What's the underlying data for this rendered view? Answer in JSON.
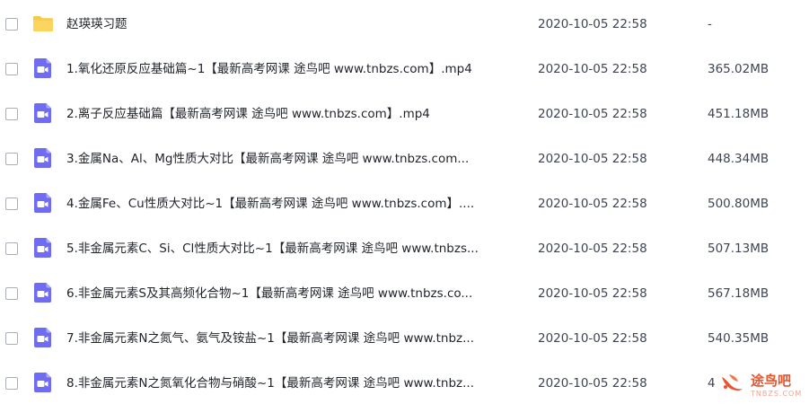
{
  "colors": {
    "folder": "#f7c948",
    "video": "#6f6cf2",
    "watermark": "#e8552d"
  },
  "files": [
    {
      "name": "赵瑛瑛习题",
      "date": "2020-10-05 22:58",
      "size": "-",
      "icon": "folder-icon"
    },
    {
      "name": "1.氧化还原反应基础篇~1【最新高考网课 途鸟吧 www.tnbzs.com】.mp4",
      "date": "2020-10-05 22:58",
      "size": "365.02MB",
      "icon": "video-file-icon"
    },
    {
      "name": "2.离子反应基础篇【最新高考网课 途鸟吧 www.tnbzs.com】.mp4",
      "date": "2020-10-05 22:58",
      "size": "451.18MB",
      "icon": "video-file-icon"
    },
    {
      "name": "3.金属Na、Al、Mg性质大对比【最新高考网课 途鸟吧 www.tnbzs.com...",
      "date": "2020-10-05 22:58",
      "size": "448.34MB",
      "icon": "video-file-icon"
    },
    {
      "name": "4.金属Fe、Cu性质大对比~1【最新高考网课 途鸟吧 www.tnbzs.com】....",
      "date": "2020-10-05 22:58",
      "size": "500.80MB",
      "icon": "video-file-icon"
    },
    {
      "name": "5.非金属元素C、Si、Cl性质大对比~1【最新高考网课 途鸟吧 www.tnbzs...",
      "date": "2020-10-05 22:58",
      "size": "507.13MB",
      "icon": "video-file-icon"
    },
    {
      "name": "6.非金属元素S及其高频化合物~1【最新高考网课 途鸟吧 www.tnbzs.co...",
      "date": "2020-10-05 22:58",
      "size": "567.18MB",
      "icon": "video-file-icon"
    },
    {
      "name": "7.非金属元素N之氮气、氨气及铵盐~1【最新高考网课 途鸟吧 www.tnbz...",
      "date": "2020-10-05 22:58",
      "size": "540.35MB",
      "icon": "video-file-icon"
    },
    {
      "name": "8.非金属元素N之氮氧化合物与硝酸~1【最新高考网课 途鸟吧 www.tnbz...",
      "date": "2020-10-05 22:58",
      "size": "4",
      "icon": "video-file-icon"
    }
  ],
  "watermark": {
    "text": "途鸟吧",
    "sub": "TNBZS.COM"
  }
}
